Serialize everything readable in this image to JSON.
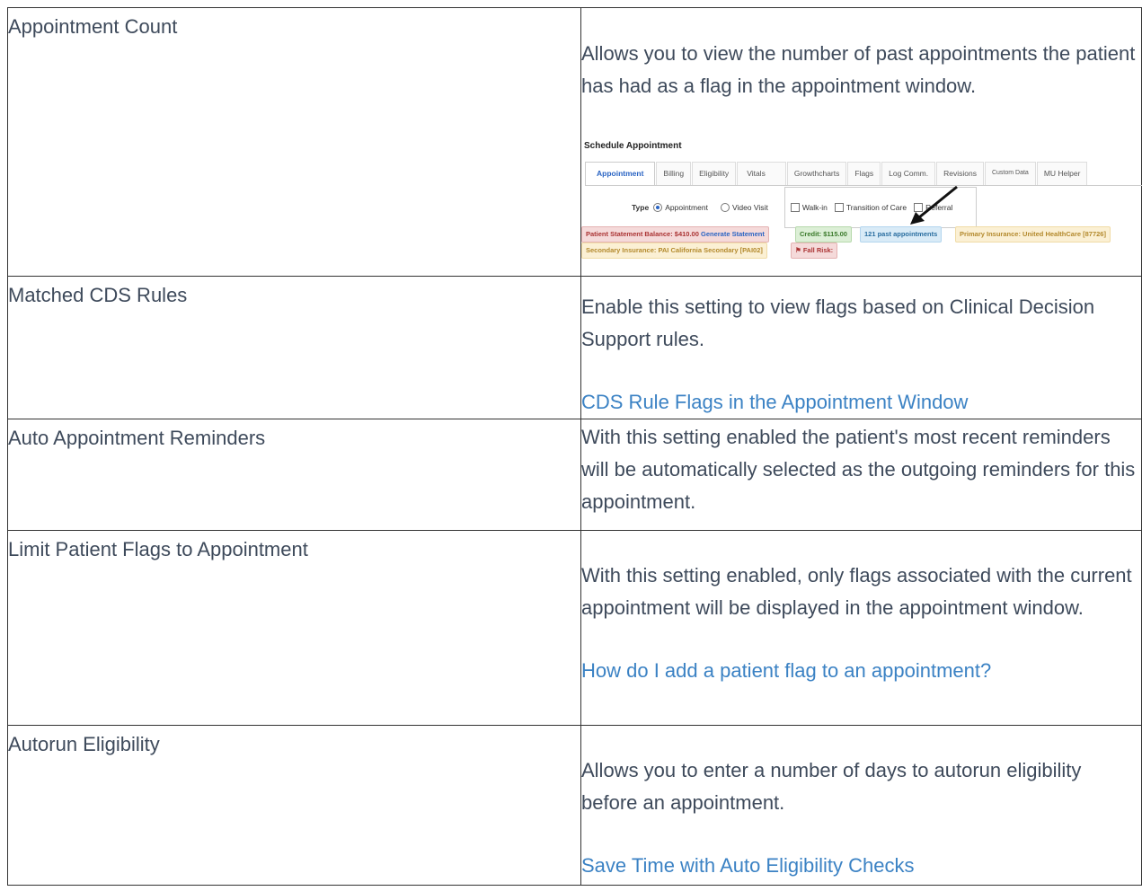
{
  "rows": [
    {
      "setting": "Appointment Count",
      "description": "Allows you to view the number of past appointments the patient has had as a flag in the appointment window."
    },
    {
      "setting": "Matched CDS Rules",
      "description": "Enable this setting to view flags based on Clinical Decision Support rules.",
      "link": "CDS Rule Flags in the Appointment Window"
    },
    {
      "setting": "Auto Appointment Reminders",
      "description": "With this setting enabled the patient's most recent reminders will be automatically selected as the outgoing reminders for this appointment."
    },
    {
      "setting": "Limit Patient Flags to Appointment",
      "description": "With this setting enabled, only flags associated with the current appointment will be displayed in the appointment window.",
      "link": "How do I add a patient flag to an appointment?"
    },
    {
      "setting": "Autorun Eligibility",
      "description": "Allows you to enter a number of days to autorun eligibility before an appointment.",
      "link": "Save Time with Auto Eligibility Checks"
    }
  ],
  "screenshot": {
    "title": "Schedule Appointment",
    "tabs": [
      "Appointment",
      "Billing",
      "Eligibility",
      "Vitals",
      "Growthcharts",
      "Flags",
      "Log Comm.",
      "Revisions",
      "Custom Data",
      "MU Helper"
    ],
    "type_label": "Type",
    "radio_appointment": "Appointment",
    "radio_video": "Video Visit",
    "check_walkin": "Walk-in",
    "check_transition": "Transition of Care",
    "check_referral": "Referral",
    "badge_balance": "Patient Statement Balance: $410.00",
    "badge_generate": "Generate Statement",
    "badge_credit": "Credit: $115.00",
    "badge_past": "121 past appointments",
    "badge_primary": "Primary Insurance: United HealthCare [87726]",
    "badge_secondary": "Secondary Insurance: PAI California Secondary [PAI02]",
    "badge_fall": "Fall Risk:",
    "colors": {
      "tab_active": "#2a64c3",
      "red": "#a33333",
      "green": "#3a7a2a",
      "blue": "#2a6ea0",
      "yellow": "#b3892c"
    }
  },
  "colors": {
    "text": "#3e4a5b",
    "link": "#3b82c4",
    "border": "#333333"
  }
}
